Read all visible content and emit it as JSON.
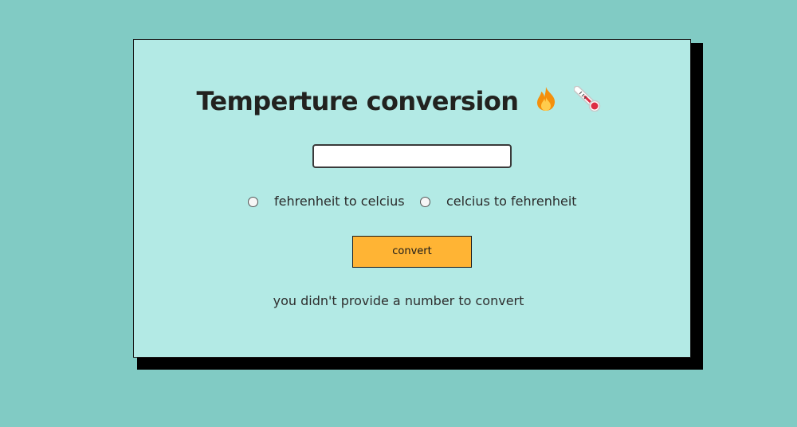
{
  "page": {
    "title": "Temperture conversion",
    "title_icons": [
      "fire-icon",
      "thermometer-icon"
    ]
  },
  "converter": {
    "input_value": "",
    "options": [
      {
        "label": "fehrenheit to celcius",
        "selected": false
      },
      {
        "label": "celcius to fehrenheit",
        "selected": false
      }
    ],
    "button_label": "convert",
    "result_text": "you didn't provide a number to convert"
  },
  "colors": {
    "background": "#81cbc4",
    "card": "#b3eae5",
    "button": "#ffb434",
    "shadow": "#000000"
  }
}
